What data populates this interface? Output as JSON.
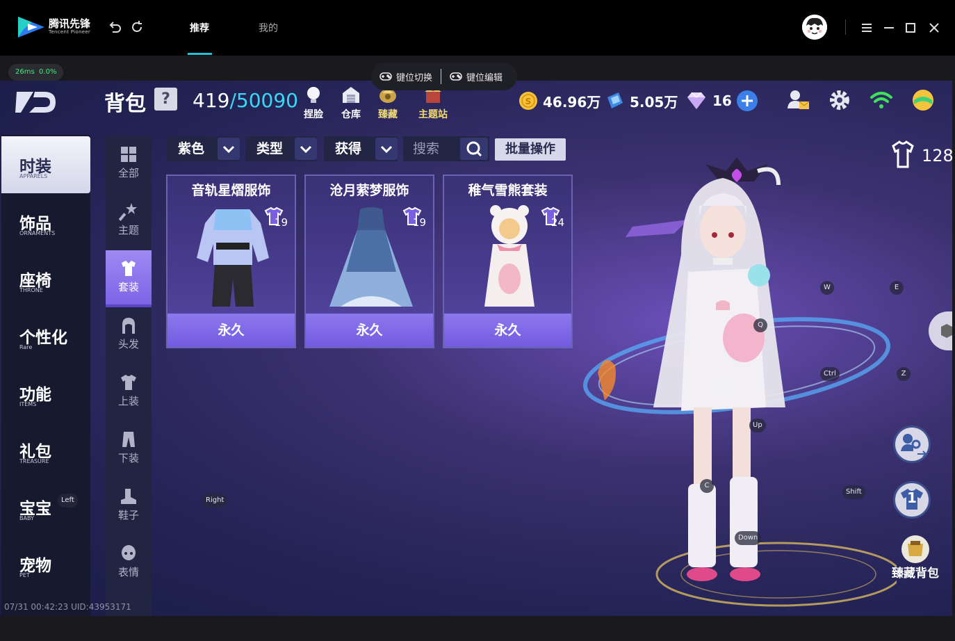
{
  "app": {
    "logo_title": "腾讯先锋",
    "logo_sub": "Tencent Pioneer",
    "tabs": [
      {
        "label": "推荐",
        "active": true
      },
      {
        "label": "我的",
        "active": false
      }
    ],
    "accent": "#1ec3d8"
  },
  "status": {
    "ping": "26ms",
    "loss": "0.0%"
  },
  "keybar": {
    "switch_label": "键位切换",
    "edit_label": "键位编辑"
  },
  "game": {
    "bag_title": "背包",
    "help": "?",
    "count_used": "419",
    "count_total": "/50090",
    "tools": [
      {
        "label": "捏脸",
        "icon": "face-bulb-icon"
      },
      {
        "label": "仓库",
        "icon": "warehouse-icon"
      },
      {
        "label": "臻藏",
        "icon": "treasure-icon"
      },
      {
        "label": "主题站",
        "icon": "theme-station-icon"
      }
    ],
    "currencies": [
      {
        "value": "46.96万",
        "icon": "gold-coin-icon"
      },
      {
        "value": "5.05万",
        "icon": "blue-ticket-icon"
      },
      {
        "value": "16",
        "icon": "diamond-icon"
      }
    ],
    "categories": [
      {
        "cn": "时装",
        "en": "APPARELS",
        "active": true
      },
      {
        "cn": "饰品",
        "en": "ORNAMENTS"
      },
      {
        "cn": "座椅",
        "en": "THRONE"
      },
      {
        "cn": "个性化",
        "en": "Rare"
      },
      {
        "cn": "功能",
        "en": "ITEMS"
      },
      {
        "cn": "礼包",
        "en": "TREASURE"
      },
      {
        "cn": "宝宝",
        "en": "BABY"
      },
      {
        "cn": "宠物",
        "en": "PET"
      }
    ],
    "subcategories": [
      {
        "label": "全部",
        "icon": "grid-icon"
      },
      {
        "label": "主题",
        "icon": "wand-icon"
      },
      {
        "label": "套装",
        "icon": "outfit-icon",
        "active": true
      },
      {
        "label": "头发",
        "icon": "hair-icon"
      },
      {
        "label": "上装",
        "icon": "shirt-icon"
      },
      {
        "label": "下装",
        "icon": "pants-icon"
      },
      {
        "label": "鞋子",
        "icon": "boot-icon"
      },
      {
        "label": "表情",
        "icon": "face-icon"
      }
    ],
    "filters": {
      "color": "紫色",
      "type": "类型",
      "obtain": "获得",
      "search_placeholder": "搜索",
      "batch": "批量操作"
    },
    "items": [
      {
        "name": "音轨星熠服饰",
        "level": "19",
        "duration": "永久"
      },
      {
        "name": "沧月萦梦服饰",
        "level": "19",
        "duration": "永久"
      },
      {
        "name": "稚气雪熊套装",
        "level": "24",
        "duration": "永久"
      }
    ],
    "wardrobe_count": "128",
    "collection_bag": "臻藏背包",
    "outfit_slot": "1",
    "keyhints": {
      "w": "W",
      "e": "E",
      "q": "Q",
      "z": "Z",
      "ctrl": "Ctrl",
      "up": "Up",
      "c": "C",
      "shift": "Shift",
      "down": "Down",
      "left": "Left",
      "right": "Right"
    },
    "footer_stamp": "07/31 00:42:23 UID:43953171"
  }
}
